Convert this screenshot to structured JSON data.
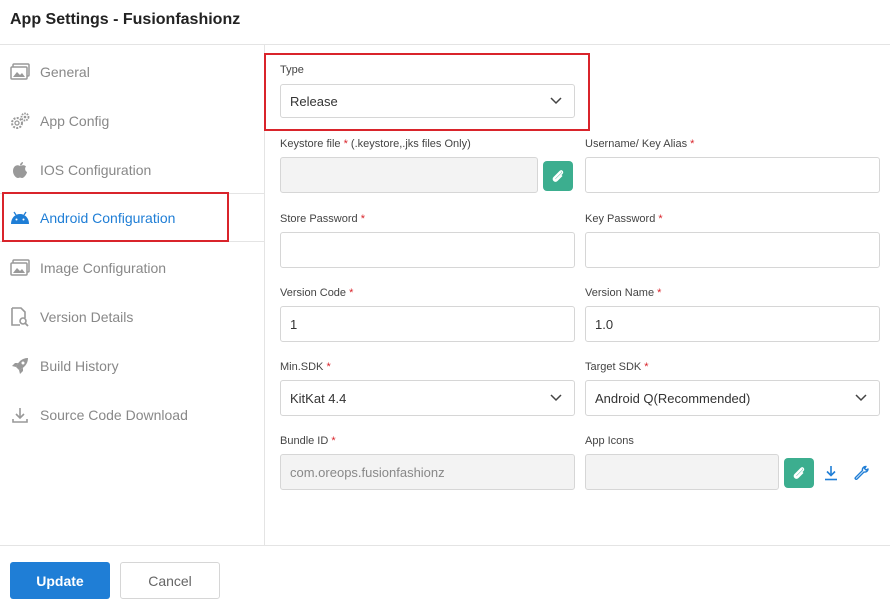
{
  "header": {
    "title": "App Settings - Fusionfashionz"
  },
  "sidebar": {
    "items": [
      {
        "label": "General",
        "icon": "image-gallery-icon"
      },
      {
        "label": "App Config",
        "icon": "gears-icon"
      },
      {
        "label": "IOS Configuration",
        "icon": "apple-icon"
      },
      {
        "label": "Android Configuration",
        "icon": "android-icon",
        "active": true
      },
      {
        "label": "Image Configuration",
        "icon": "image-gallery-icon"
      },
      {
        "label": "Version Details",
        "icon": "document-search-icon"
      },
      {
        "label": "Build History",
        "icon": "rocket-icon"
      },
      {
        "label": "Source Code Download",
        "icon": "download-icon"
      }
    ]
  },
  "form": {
    "type": {
      "label": "Type",
      "value": "Release"
    },
    "keystore": {
      "label": "Keystore file",
      "hint": " (.keystore,.jks files Only)",
      "value": ""
    },
    "username": {
      "label": "Username/ Key Alias",
      "value": ""
    },
    "store_password": {
      "label": "Store Password",
      "value": ""
    },
    "key_password": {
      "label": "Key Password",
      "value": ""
    },
    "version_code": {
      "label": "Version Code",
      "value": "1"
    },
    "version_name": {
      "label": "Version Name",
      "value": "1.0"
    },
    "min_sdk": {
      "label": "Min.SDK",
      "value": "KitKat 4.4"
    },
    "target_sdk": {
      "label": "Target SDK",
      "value": "Android Q(Recommended)"
    },
    "bundle_id": {
      "label": "Bundle ID",
      "value": "com.oreops.fusionfashionz"
    },
    "app_icons": {
      "label": "App Icons",
      "value": ""
    },
    "required_mark": " *"
  },
  "footer": {
    "update_label": "Update",
    "cancel_label": "Cancel"
  },
  "colors": {
    "accent": "#1f7ed6",
    "attach": "#3cae8f",
    "highlight": "#d9242b"
  }
}
